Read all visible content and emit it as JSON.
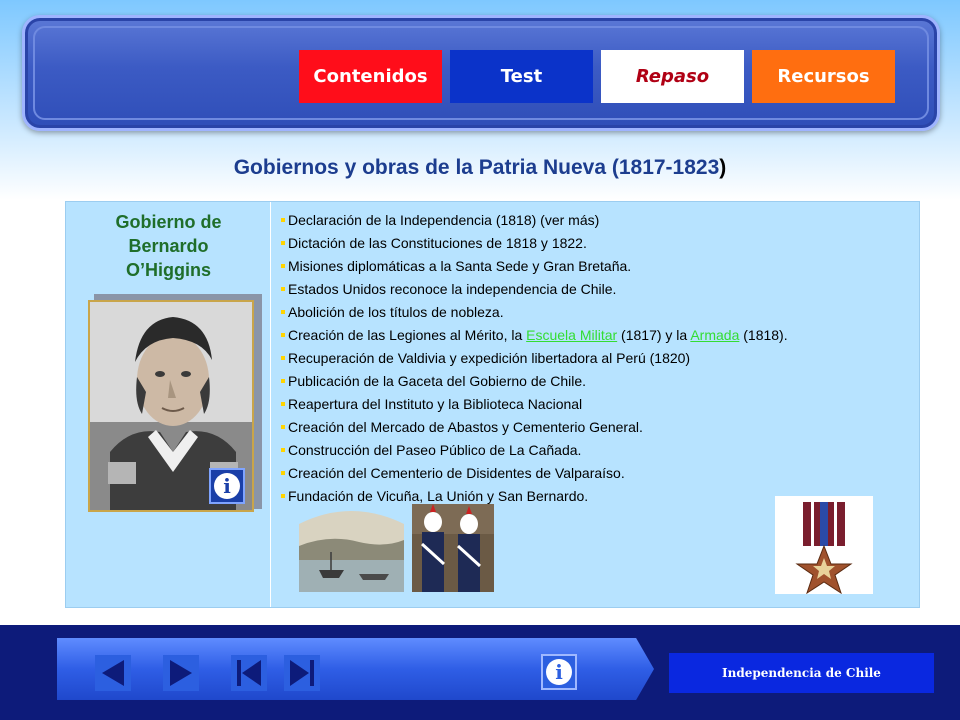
{
  "nav": {
    "tabs": [
      {
        "label": "Contenidos"
      },
      {
        "label": "Test"
      },
      {
        "label": "Repaso"
      },
      {
        "label": "Recursos"
      }
    ]
  },
  "page": {
    "title_main": "Gobiernos y obras de la Patria Nueva (1817-1823",
    "title_close": ")"
  },
  "left_panel": {
    "title_line1": "Gobierno de",
    "title_line2": "Bernardo",
    "title_line3": "O’Higgins"
  },
  "bullets": {
    "b1": "Declaración de la Independencia (1818) (ver más)",
    "b2": "Dictación de las Constituciones de 1818 y 1822.",
    "b3": "Misiones diplomáticas a la Santa Sede y Gran Bretaña.",
    "b4": "Estados Unidos reconoce la independencia de Chile.",
    "b5": "Abolición de los títulos de nobleza.",
    "b6_pre": "Creación de las Legiones al Mérito, la ",
    "b6_link1": "Escuela Militar",
    "b6_mid": " (1817) y la ",
    "b6_link2": "Armada",
    "b6_post": " (1818).",
    "b7": "Recuperación de Valdivia y expedición libertadora al Perú (1820)",
    "b8": "Publicación de la Gaceta del Gobierno de Chile.",
    "b9": "Reapertura del Instituto y la Biblioteca Nacional",
    "b10": "Creación del Mercado de Abastos y Cementerio General.",
    "b11": "Construcción del Paseo Público de La Cañada.",
    "b12": "Creación del Cementerio de Disidentes de Valparaíso.",
    "b13": "Fundación de Vicuña, La Unión y San Bernardo."
  },
  "footer": {
    "label": "Independencia de Chile"
  },
  "icons": {
    "info": "i"
  },
  "colors": {
    "tab_contenidos": "#ff0d1a",
    "tab_test": "#0b33c9",
    "tab_repaso": "#ffffff",
    "tab_recursos": "#ff6e10",
    "title": "#1c3d8f",
    "panel": "#b7e3ff",
    "gov_title": "#1f6e2a",
    "link": "#33dd33",
    "footer": "#0d1b7a"
  }
}
